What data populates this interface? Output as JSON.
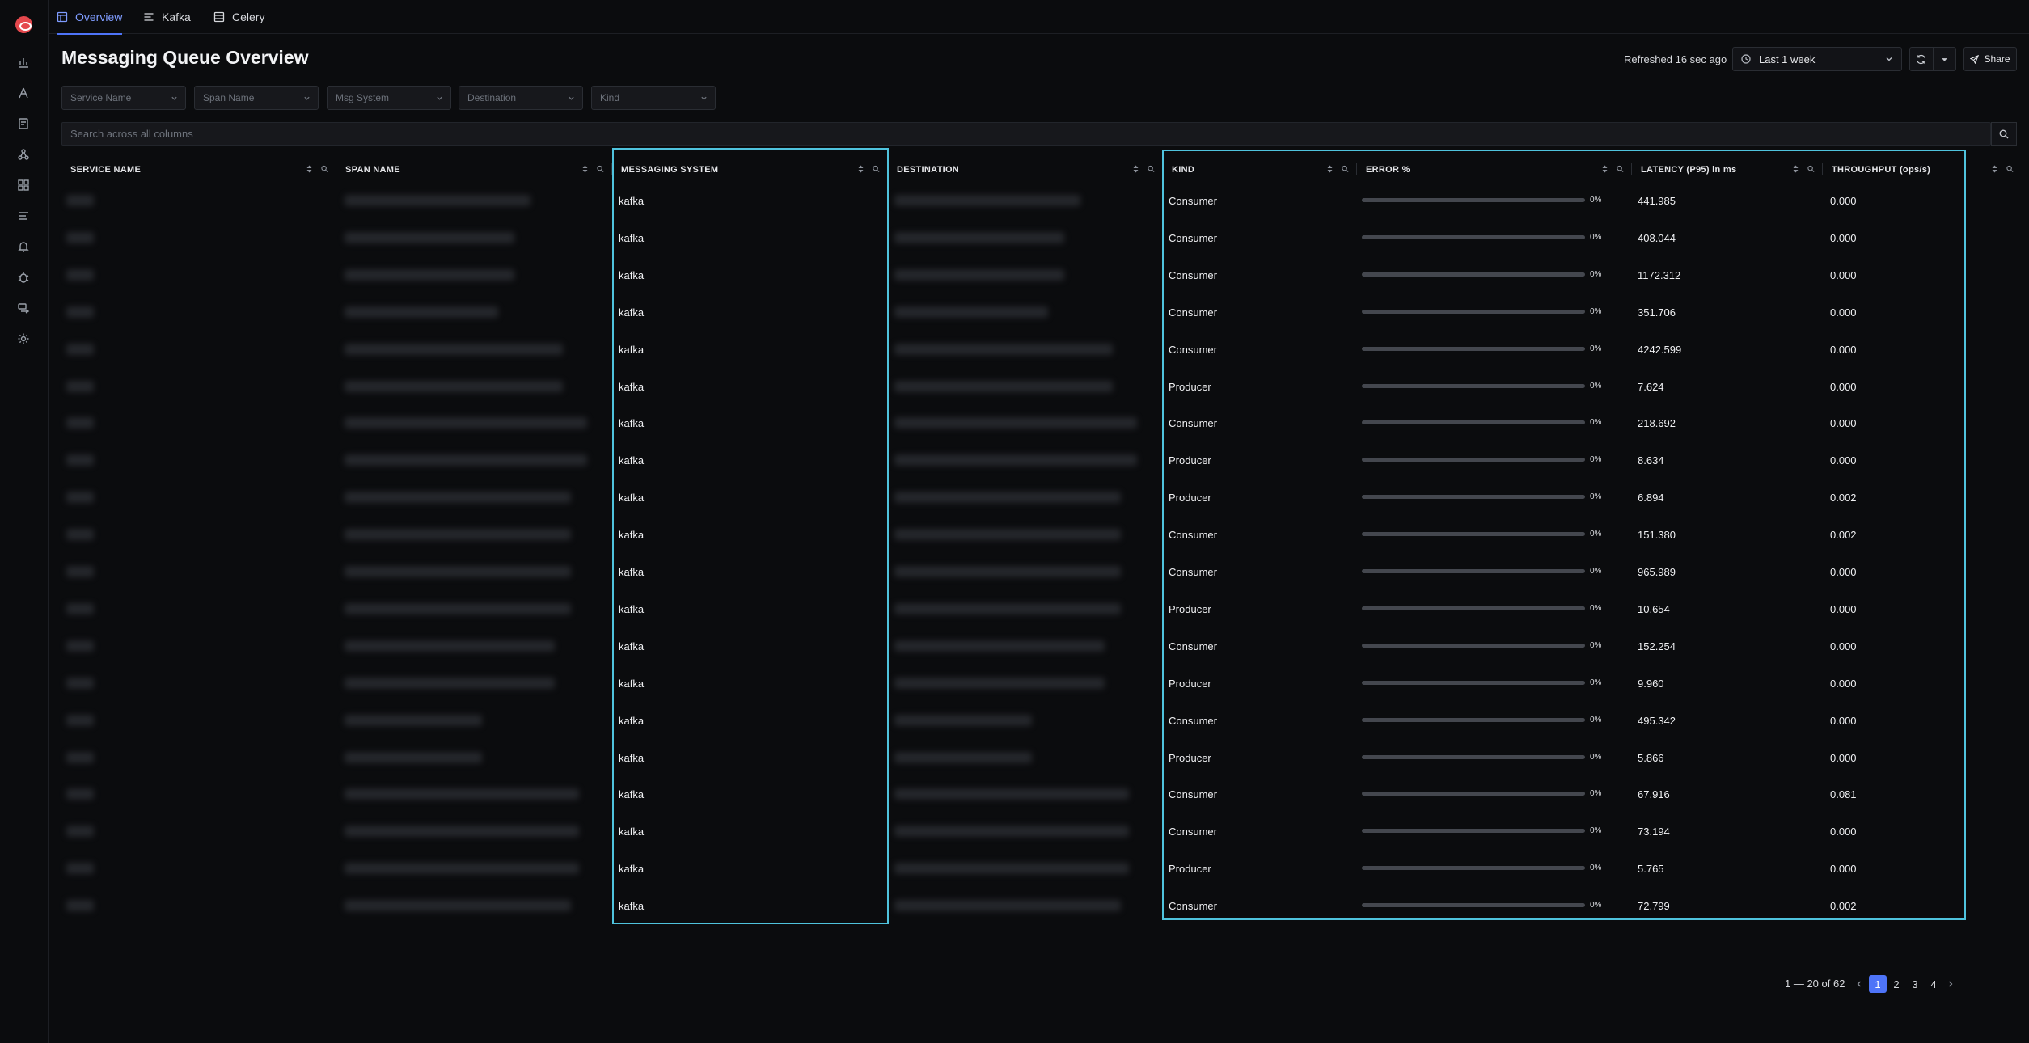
{
  "sidebar": {
    "icons": [
      "chart-icon",
      "services-icon",
      "traces-icon",
      "service-map-icon",
      "dashboards-icon",
      "logs-icon",
      "alerts-icon",
      "exceptions-icon",
      "messaging-queues-icon",
      "settings-icon"
    ]
  },
  "tabs": [
    {
      "label": "Overview",
      "icon": "overview-icon"
    },
    {
      "label": "Kafka",
      "icon": "kafka-icon"
    },
    {
      "label": "Celery",
      "icon": "celery-icon"
    }
  ],
  "header": {
    "title": "Messaging Queue Overview",
    "refreshed": "Refreshed 16 sec ago",
    "time_range": "Last 1 week",
    "share_label": "Share"
  },
  "filters": [
    "Service Name",
    "Span Name",
    "Msg System",
    "Destination",
    "Kind"
  ],
  "search": {
    "placeholder": "Search across all columns"
  },
  "table": {
    "columns": [
      "SERVICE NAME",
      "SPAN NAME",
      "MESSAGING SYSTEM",
      "DESTINATION",
      "KIND",
      "ERROR %",
      "LATENCY (P95) in ms",
      "THROUGHPUT (ops/s)"
    ],
    "rows": [
      {
        "system": "kafka",
        "kind": "Consumer",
        "error": "0%",
        "error_value": 0,
        "latency": "441.985",
        "throughput": "0.000"
      },
      {
        "system": "kafka",
        "kind": "Consumer",
        "error": "0%",
        "error_value": 0,
        "latency": "408.044",
        "throughput": "0.000"
      },
      {
        "system": "kafka",
        "kind": "Consumer",
        "error": "0%",
        "error_value": 0,
        "latency": "1172.312",
        "throughput": "0.000"
      },
      {
        "system": "kafka",
        "kind": "Consumer",
        "error": "0%",
        "error_value": 0,
        "latency": "351.706",
        "throughput": "0.000"
      },
      {
        "system": "kafka",
        "kind": "Consumer",
        "error": "0%",
        "error_value": 0,
        "latency": "4242.599",
        "throughput": "0.000"
      },
      {
        "system": "kafka",
        "kind": "Producer",
        "error": "0%",
        "error_value": 0,
        "latency": "7.624",
        "throughput": "0.000"
      },
      {
        "system": "kafka",
        "kind": "Consumer",
        "error": "0%",
        "error_value": 0,
        "latency": "218.692",
        "throughput": "0.000"
      },
      {
        "system": "kafka",
        "kind": "Producer",
        "error": "0%",
        "error_value": 0,
        "latency": "8.634",
        "throughput": "0.000"
      },
      {
        "system": "kafka",
        "kind": "Producer",
        "error": "0%",
        "error_value": 0,
        "latency": "6.894",
        "throughput": "0.002"
      },
      {
        "system": "kafka",
        "kind": "Consumer",
        "error": "0%",
        "error_value": 0,
        "latency": "151.380",
        "throughput": "0.002"
      },
      {
        "system": "kafka",
        "kind": "Consumer",
        "error": "0%",
        "error_value": 0,
        "latency": "965.989",
        "throughput": "0.000"
      },
      {
        "system": "kafka",
        "kind": "Producer",
        "error": "0%",
        "error_value": 0,
        "latency": "10.654",
        "throughput": "0.000"
      },
      {
        "system": "kafka",
        "kind": "Consumer",
        "error": "0%",
        "error_value": 0,
        "latency": "152.254",
        "throughput": "0.000"
      },
      {
        "system": "kafka",
        "kind": "Producer",
        "error": "0%",
        "error_value": 0,
        "latency": "9.960",
        "throughput": "0.000"
      },
      {
        "system": "kafka",
        "kind": "Consumer",
        "error": "0%",
        "error_value": 0,
        "latency": "495.342",
        "throughput": "0.000"
      },
      {
        "system": "kafka",
        "kind": "Producer",
        "error": "0%",
        "error_value": 0,
        "latency": "5.866",
        "throughput": "0.000"
      },
      {
        "system": "kafka",
        "kind": "Consumer",
        "error": "0%",
        "error_value": 0,
        "latency": "67.916",
        "throughput": "0.081"
      },
      {
        "system": "kafka",
        "kind": "Consumer",
        "error": "0%",
        "error_value": 0,
        "latency": "73.194",
        "throughput": "0.000"
      },
      {
        "system": "kafka",
        "kind": "Producer",
        "error": "0%",
        "error_value": 0,
        "latency": "5.765",
        "throughput": "0.000"
      },
      {
        "system": "kafka",
        "kind": "Consumer",
        "error": "0%",
        "error_value": 0,
        "latency": "72.799",
        "throughput": "0.002"
      }
    ]
  },
  "pagination": {
    "summary": "1 — 20 of 62",
    "pages": [
      "1",
      "2",
      "3",
      "4"
    ],
    "current": "1"
  },
  "colors": {
    "accent": "#4e74f8",
    "highlight": "#4fc3dd",
    "logo": "#e5484d"
  }
}
